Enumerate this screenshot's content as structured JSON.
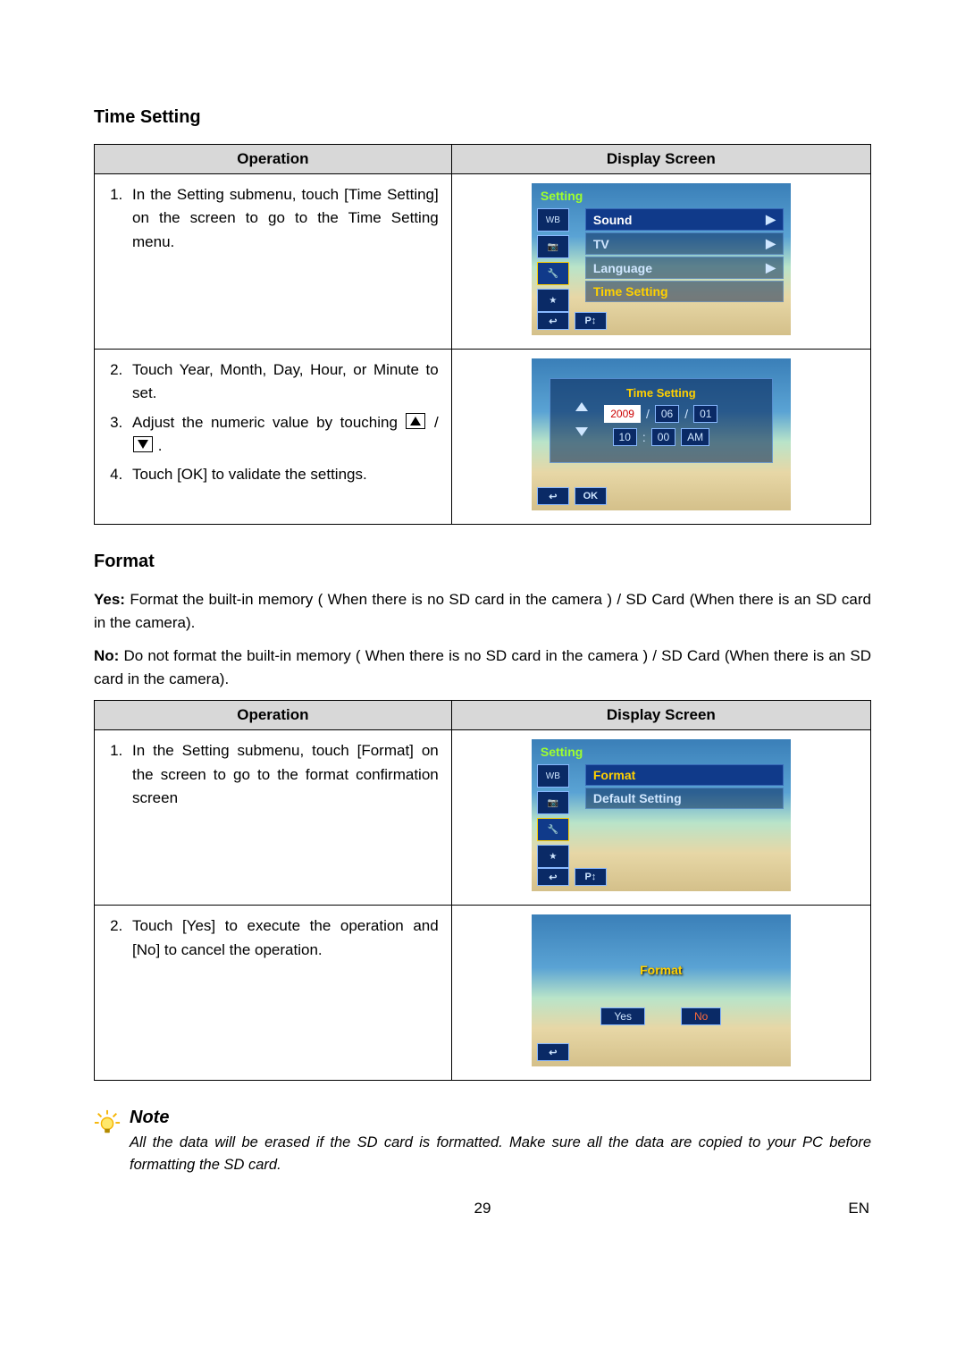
{
  "section1": {
    "heading": "Time Setting",
    "table": {
      "col_operation": "Operation",
      "col_display": "Display Screen",
      "row1": {
        "step1": "In the Setting submenu, touch [Time Setting] on the screen to go to the Time Setting menu."
      },
      "row2": {
        "step2": "Touch Year, Month, Day, Hour, or Minute to set.",
        "step3_prefix": "Adjust the numeric value by touching ",
        "step3_suffix": " .",
        "step4": "Touch [OK] to validate the settings."
      }
    },
    "screen1": {
      "title": "Setting",
      "items": [
        "Sound",
        "TV",
        "Language",
        "Time Setting"
      ],
      "side_icons": [
        "WB",
        "📷",
        "🔧",
        "★"
      ],
      "bottom": [
        "↩",
        "P↕"
      ]
    },
    "screen2": {
      "panel_title": "Time Setting",
      "date": {
        "year": "2009",
        "month": "06",
        "day": "01"
      },
      "time": {
        "hour": "10",
        "minute": "00",
        "ampm": "AM"
      },
      "bottom": [
        "↩",
        "OK"
      ]
    }
  },
  "section2": {
    "heading": "Format",
    "yes_line_label": "Yes:",
    "yes_line": " Format the built-in memory ( When there is no SD card in the camera ) / SD Card (When there is an SD card in the camera).",
    "no_line_label": "No:",
    "no_line": " Do not format the built-in memory ( When there is no SD card in the camera ) / SD Card (When there is an SD card in the camera).",
    "table": {
      "col_operation": "Operation",
      "col_display": "Display Screen",
      "row1": {
        "step1": "In the Setting submenu, touch [Format] on the screen to go to the format confirmation screen"
      },
      "row2": {
        "step2": "Touch [Yes] to execute the operation and [No] to cancel the operation."
      }
    },
    "screen1": {
      "title": "Setting",
      "items": [
        "Format",
        "Default Setting"
      ],
      "side_icons": [
        "WB",
        "📷",
        "🔧",
        "★"
      ],
      "bottom": [
        "↩",
        "P↕"
      ]
    },
    "screen2": {
      "title": "Format",
      "yes": "Yes",
      "no": "No",
      "bottom": [
        "↩"
      ]
    }
  },
  "note": {
    "heading": "Note",
    "text": "All the data will be erased if the SD card is formatted. Make sure all the data are copied to your PC before formatting the SD card."
  },
  "footer": {
    "page": "29",
    "lang": "EN"
  }
}
